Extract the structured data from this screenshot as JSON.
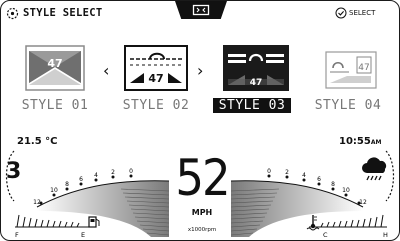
{
  "header": {
    "title": "STYLE SELECT",
    "select_label": "SELECT",
    "title_icon": "dial-icon",
    "select_icon": "check-circle-icon",
    "center_icon": "frame-icon"
  },
  "styles": [
    {
      "label": "STYLE 01",
      "number": "47",
      "active": false
    },
    {
      "label": "STYLE 02",
      "number": "47",
      "active": false
    },
    {
      "label": "STYLE 03",
      "number": "47",
      "active": true
    },
    {
      "label": "STYLE 04",
      "number": "47",
      "active": false
    }
  ],
  "nav": {
    "prev": "‹",
    "next": "›"
  },
  "status": {
    "temperature": "21.5 °C",
    "time": "10:55",
    "time_suffix": "AM",
    "weather_icon": "rain-cloud-icon"
  },
  "gauges": {
    "gear": "3",
    "speed": "52",
    "speed_unit": "MPH",
    "rpm_unit": "x1000rpm",
    "left_ticks": [
      "12",
      "10",
      "8",
      "6",
      "4",
      "2",
      "0"
    ],
    "right_ticks": [
      "0",
      "2",
      "4",
      "6",
      "8",
      "10",
      "12"
    ],
    "fuel": {
      "empty": "E",
      "full": "F"
    },
    "coolant": {
      "cold": "C",
      "hot": "H"
    }
  },
  "colors": {
    "accent": "#111111",
    "muted": "#777777",
    "ramp_start": "#ffffff",
    "ramp_end": "#7a7a7a"
  }
}
